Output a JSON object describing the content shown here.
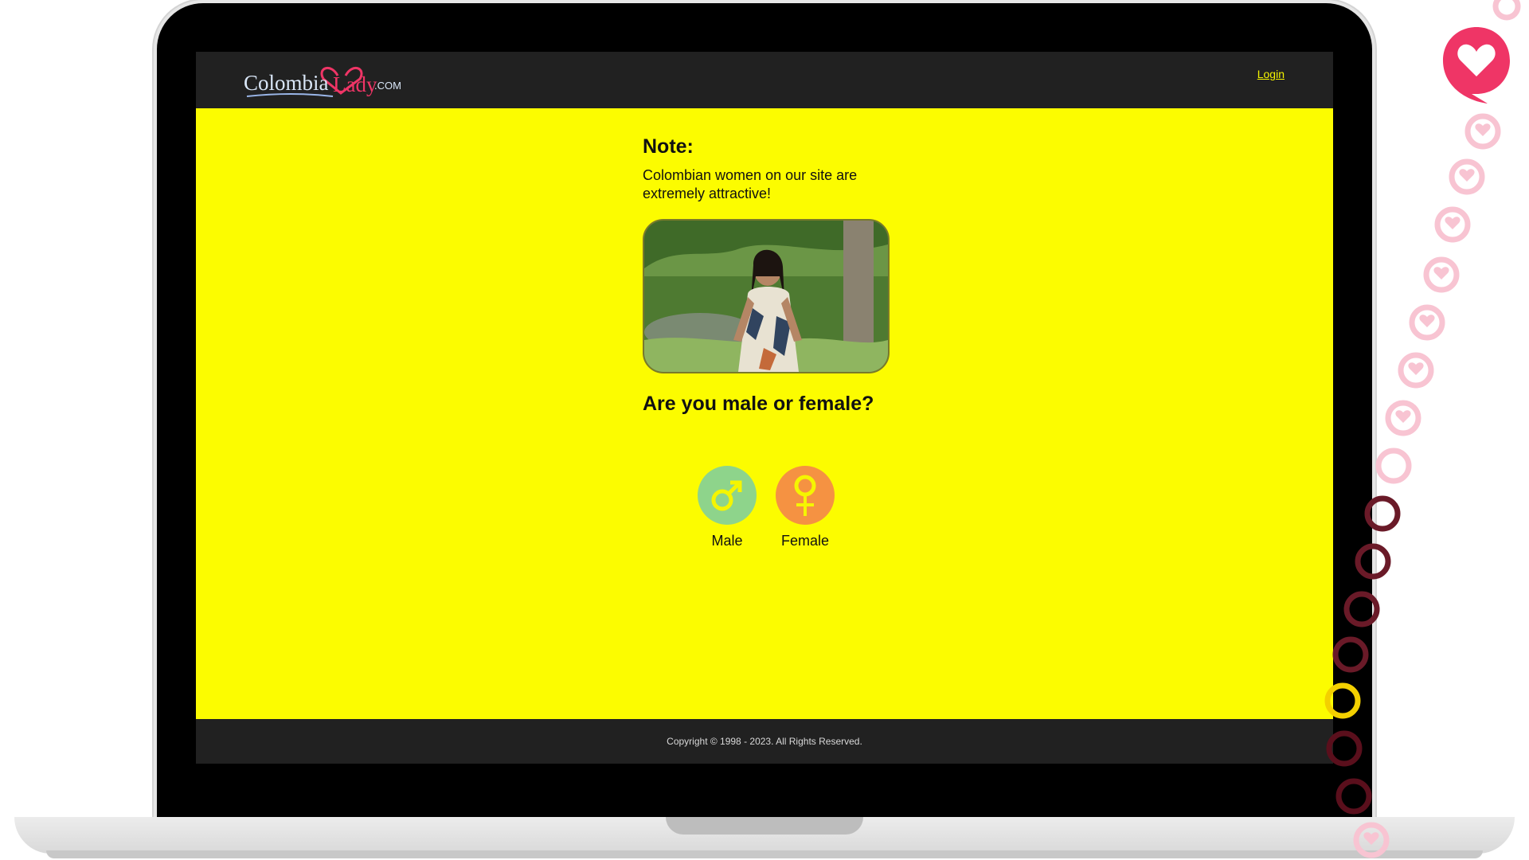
{
  "site": {
    "logo": {
      "part1": "Colombia",
      "part2": "Lady",
      "suffix": ".COM"
    },
    "header": {
      "login_label": "Login"
    },
    "note": {
      "title": "Note:",
      "text": "Colombian women on our site are extremely attractive!"
    },
    "question": "Are you male or female?",
    "genders": [
      {
        "label": "Male",
        "icon": "male-symbol-icon",
        "color": "#8ed48b"
      },
      {
        "label": "Female",
        "icon": "female-symbol-icon",
        "color": "#f59242"
      }
    ],
    "footer": {
      "copyright": "Copyright © 1998 - 2023. All Rights Reserved."
    }
  },
  "colors": {
    "page_background": "#fcfc00",
    "header_background": "#212121",
    "accent_pink": "#ef3566",
    "link_yellow": "#f5f500"
  },
  "decoration": {
    "chat_icon": "heart-chat-bubble-icon"
  }
}
